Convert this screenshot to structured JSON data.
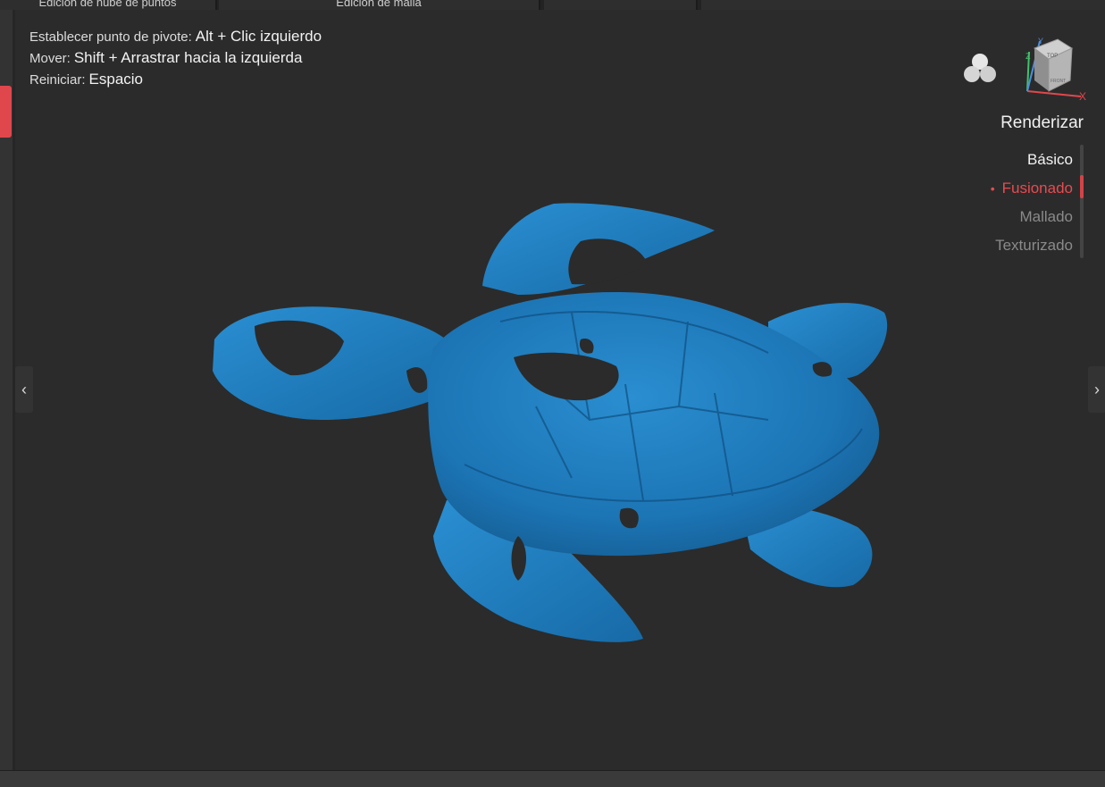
{
  "tabs": [
    {
      "label": "Edición de nube de puntos"
    },
    {
      "label": "Edición de malla"
    },
    {
      "label": ""
    },
    {
      "label": ""
    }
  ],
  "hints": [
    {
      "key": "Establecer punto de pivote:",
      "value": "Alt + Clic izquierdo"
    },
    {
      "key": "Mover:",
      "value": "Shift + Arrastrar hacia la izquierda"
    },
    {
      "key": "Reiniciar:",
      "value": "Espacio"
    }
  ],
  "render": {
    "title": "Renderizar",
    "items": [
      {
        "label": "Básico"
      },
      {
        "label": "Fusionado",
        "selected": true
      },
      {
        "label": "Mallado"
      },
      {
        "label": "Texturizado"
      }
    ]
  },
  "view_cube": {
    "top": "TOP",
    "front": "FRONT",
    "axis_x": "X",
    "axis_y": "Y",
    "axis_z": "Z"
  },
  "nav": {
    "prev": "‹",
    "next": "›"
  },
  "icons": {
    "display_mode": "circles-icon",
    "view_cube": "view-cube-icon"
  },
  "colors": {
    "accent": "#e0474c",
    "model": "#1e78b4",
    "background": "#2b2b2b"
  }
}
